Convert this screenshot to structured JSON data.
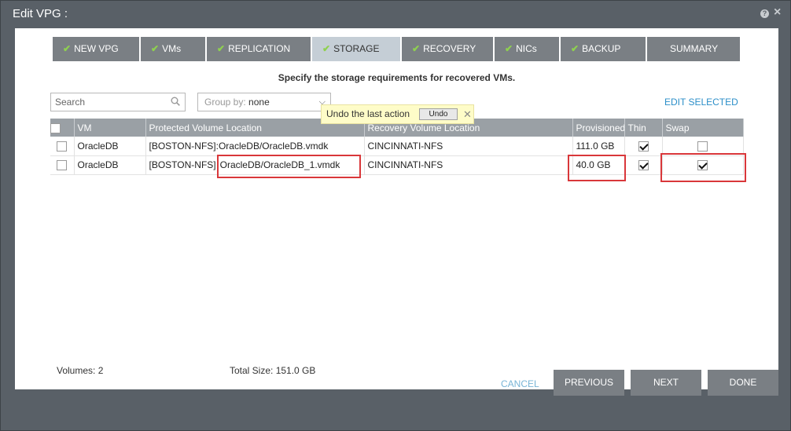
{
  "window": {
    "title": "Edit VPG :"
  },
  "steps": [
    {
      "label": "NEW VPG",
      "done": true
    },
    {
      "label": "VMs",
      "done": true
    },
    {
      "label": "REPLICATION",
      "done": true
    },
    {
      "label": "STORAGE",
      "done": true,
      "active": true
    },
    {
      "label": "RECOVERY",
      "done": true
    },
    {
      "label": "NICs",
      "done": true
    },
    {
      "label": "BACKUP",
      "done": true
    },
    {
      "label": "SUMMARY",
      "done": false
    }
  ],
  "instruction": "Specify the storage requirements for recovered VMs.",
  "search": {
    "placeholder": "Search",
    "value": ""
  },
  "group_by": {
    "label": "Group by:",
    "value": "none"
  },
  "undo_tip": {
    "text": "Undo the last action",
    "button": "Undo"
  },
  "edit_selected": "EDIT SELECTED",
  "table": {
    "columns": [
      "VM",
      "Protected Volume Location",
      "Recovery Volume Location",
      "Provisioned",
      "Thin",
      "Swap"
    ],
    "rows": [
      {
        "vm": "OracleDB",
        "protected": "[BOSTON-NFS]:OracleDB/OracleDB.vmdk",
        "recovery": "CINCINNATI-NFS",
        "provisioned": "111.0 GB",
        "thin": true,
        "swap": false
      },
      {
        "vm": "OracleDB",
        "protected_prefix": "[BOSTON-NFS]",
        "protected_path": "OracleDB/OracleDB_1.vmdk",
        "recovery": "CINCINNATI-NFS",
        "provisioned": "40.0 GB",
        "thin": true,
        "swap": true
      }
    ]
  },
  "stats": {
    "volumes": "Volumes: 2",
    "total_size": "Total Size: 151.0 GB"
  },
  "buttons": {
    "cancel": "CANCEL",
    "previous": "PREVIOUS",
    "next": "NEXT",
    "done": "DONE"
  },
  "colors": {
    "accent_check": "#8fd14f",
    "highlight": "#d9373a",
    "link": "#2c8fc9"
  }
}
